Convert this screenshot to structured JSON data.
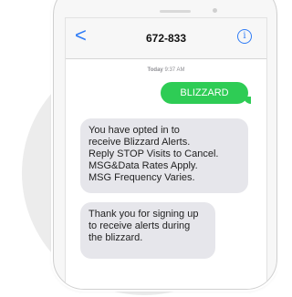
{
  "conversation": {
    "back_glyph": "<",
    "contact": "672-833",
    "info_glyph": "i",
    "timestamp_day": "Today",
    "timestamp_time": "9:37 AM"
  },
  "messages": {
    "sent_text": "BLIZZARD",
    "received_1": "You have opted in to\nreceive Blizzard Alerts.\nReply STOP Visits to Cancel.\nMSG&Data Rates Apply.\nMSG Frequency Varies.",
    "received_2": "Thank you for signing up\nto receive alerts during\nthe blizzard."
  },
  "colors": {
    "accent": "#2f7cf6",
    "sent_bubble": "#2ecc55",
    "received_bubble": "#e6e6eb",
    "background_circle": "#ececec"
  },
  "icons": {
    "back": "chevron-left-icon",
    "info": "info-icon"
  }
}
